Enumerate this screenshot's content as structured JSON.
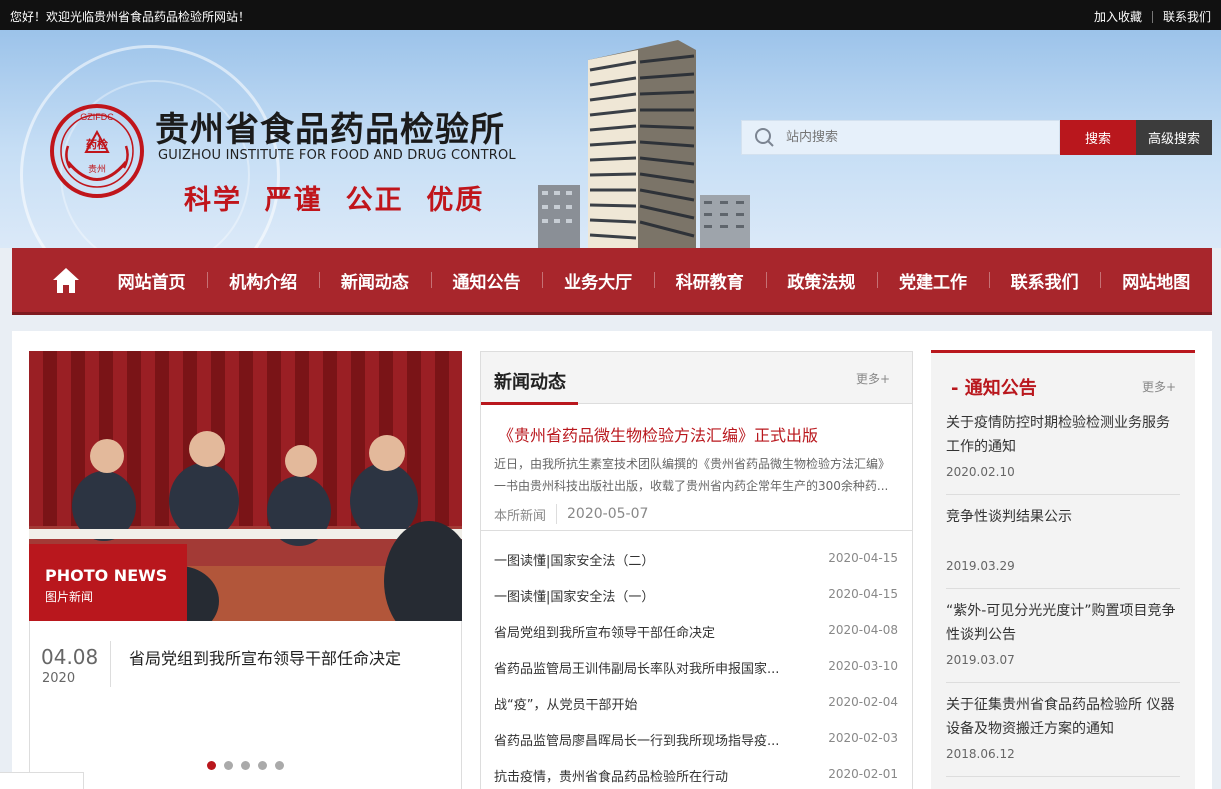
{
  "topbar": {
    "welcome": "您好！欢迎光临贵州省食品药品检验所网站！",
    "add_favorite": "加入收藏",
    "contact": "联系我们"
  },
  "header": {
    "logo_text_top": "GZIFDC",
    "logo_text_mid": "药检",
    "logo_text_bottom": "贵州",
    "title": "贵州省食品药品检验所",
    "subtitle": "GUIZHOU INSTITUTE FOR FOOD AND DRUG CONTROL",
    "slogan": "科学  严谨  公正  优质"
  },
  "search": {
    "placeholder": "站内搜索",
    "search_label": "搜索",
    "advanced_label": "高级搜索"
  },
  "nav": {
    "items": [
      "网站首页",
      "机构介绍",
      "新闻动态",
      "通知公告",
      "业务大厅",
      "科研教育",
      "政策法规",
      "党建工作",
      "联系我们",
      "网站地图"
    ]
  },
  "photo_news": {
    "tag_en": "PHOTO NEWS",
    "tag_cn": "图片新闻",
    "date": "04.08",
    "year": "2020",
    "title": "省局党组到我所宣布领导干部任命决定",
    "slides": 5,
    "active_slide": 1
  },
  "news": {
    "title": "新闻动态",
    "more": "更多+",
    "feature": {
      "title": "《贵州省药品微生物检验方法汇编》正式出版",
      "summary": "近日，由我所抗生素室技术团队编撰的《贵州省药品微生物检验方法汇编》一书由贵州科技出版社出版，收载了贵州省内药企常年生产的300余种药...",
      "source": "本所新闻",
      "date": "2020-05-07"
    },
    "items": [
      {
        "title": "一图读懂|国家安全法（二）",
        "date": "2020-04-15"
      },
      {
        "title": "一图读懂|国家安全法（一）",
        "date": "2020-04-15"
      },
      {
        "title": "省局党组到我所宣布领导干部任命决定",
        "date": "2020-04-08"
      },
      {
        "title": "省药品监管局王训伟副局长率队对我所申报国家...",
        "date": "2020-03-10"
      },
      {
        "title": "战“疫”，从党员干部开始",
        "date": "2020-02-04"
      },
      {
        "title": "省药品监管局廖昌晖局长一行到我所现场指导疫...",
        "date": "2020-02-03"
      },
      {
        "title": "抗击疫情，贵州省食品药品检验所在行动",
        "date": "2020-02-01"
      }
    ]
  },
  "notice": {
    "title": "- 通知公告",
    "more": "更多+",
    "items": [
      {
        "title": "关于疫情防控时期检验检测业务服务工作的通知",
        "date": "2020.02.10"
      },
      {
        "title": "竞争性谈判结果公示",
        "date": "2019.03.29"
      },
      {
        "title": "“紫外-可见分光光度计”购置项目竞争性谈判公告",
        "date": "2019.03.07"
      },
      {
        "title": "关于征集贵州省食品药品检验所 仪器设备及物资搬迁方案的通知",
        "date": "2018.06.12"
      }
    ]
  },
  "colors": {
    "brand_red": "#b9171d",
    "nav_red": "#a8262c"
  }
}
